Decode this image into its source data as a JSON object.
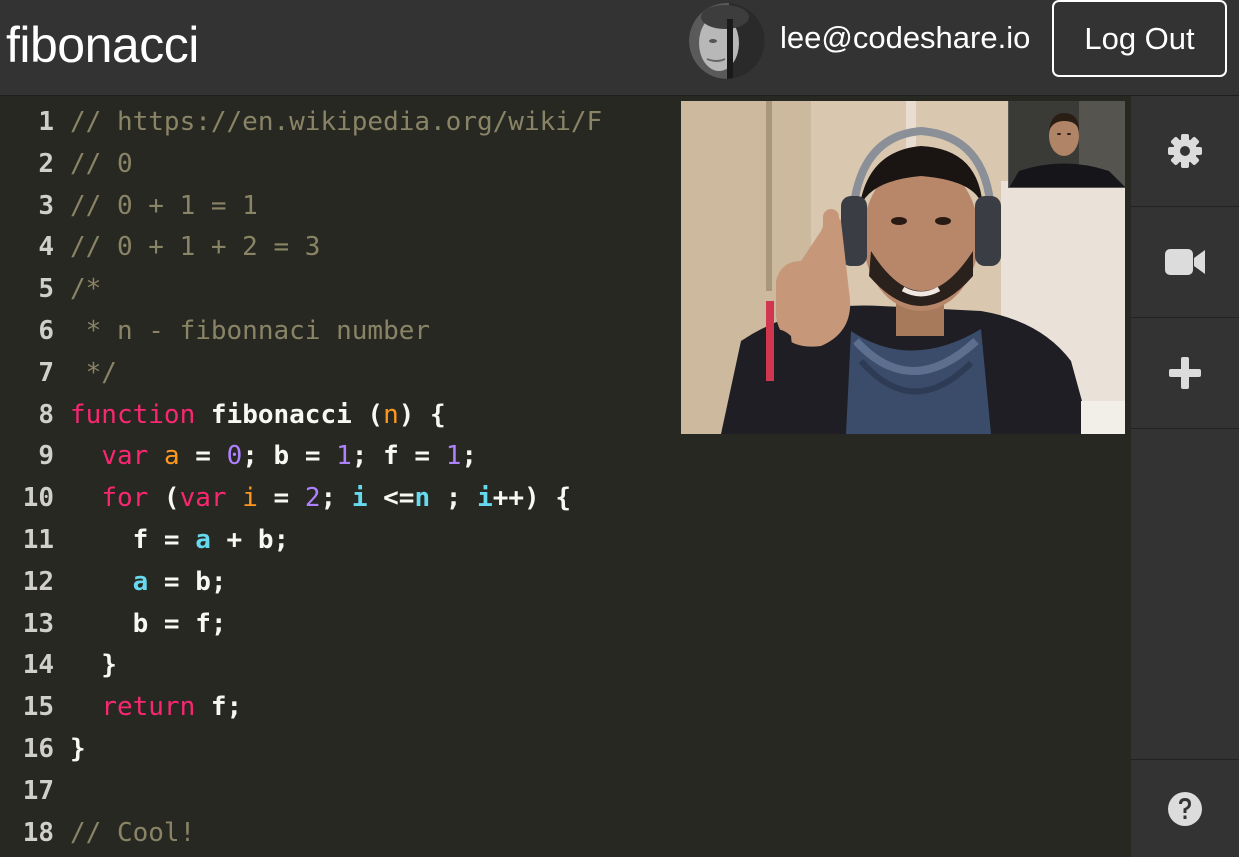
{
  "header": {
    "title": "fibonacci",
    "user_email": "lee@codeshare.io",
    "logout_label": "Log Out",
    "avatar_icon": "user-avatar-photo"
  },
  "editor": {
    "lines": [
      {
        "num": "1",
        "tokens": [
          {
            "t": "// https://en.wikipedia.org/wiki/F",
            "c": "t-comment"
          }
        ]
      },
      {
        "num": "2",
        "tokens": [
          {
            "t": "// 0",
            "c": "t-comment"
          }
        ]
      },
      {
        "num": "3",
        "tokens": [
          {
            "t": "// 0 + 1 = 1",
            "c": "t-comment"
          }
        ]
      },
      {
        "num": "4",
        "tokens": [
          {
            "t": "// 0 + 1 + 2 = 3",
            "c": "t-comment"
          }
        ]
      },
      {
        "num": "5",
        "tokens": [
          {
            "t": "/*",
            "c": "t-comment"
          }
        ]
      },
      {
        "num": "6",
        "tokens": [
          {
            "t": " * n - fibonnaci number",
            "c": "t-comment"
          }
        ]
      },
      {
        "num": "7",
        "tokens": [
          {
            "t": " */",
            "c": "t-comment"
          }
        ]
      },
      {
        "num": "8",
        "tokens": [
          {
            "t": "function",
            "c": "t-kw"
          },
          {
            "t": " fibonacci (",
            "c": "t-plain"
          },
          {
            "t": "n",
            "c": "t-var"
          },
          {
            "t": ") {",
            "c": "t-plain"
          }
        ]
      },
      {
        "num": "9",
        "tokens": [
          {
            "t": "  ",
            "c": "t-plain"
          },
          {
            "t": "var",
            "c": "t-kw"
          },
          {
            "t": " ",
            "c": "t-plain"
          },
          {
            "t": "a",
            "c": "t-var"
          },
          {
            "t": " = ",
            "c": "t-plain"
          },
          {
            "t": "0",
            "c": "t-num"
          },
          {
            "t": "; b = ",
            "c": "t-plain"
          },
          {
            "t": "1",
            "c": "t-num"
          },
          {
            "t": "; f = ",
            "c": "t-plain"
          },
          {
            "t": "1",
            "c": "t-num"
          },
          {
            "t": ";",
            "c": "t-plain"
          }
        ]
      },
      {
        "num": "10",
        "tokens": [
          {
            "t": "  ",
            "c": "t-plain"
          },
          {
            "t": "for",
            "c": "t-kw"
          },
          {
            "t": " (",
            "c": "t-plain"
          },
          {
            "t": "var",
            "c": "t-kw"
          },
          {
            "t": " ",
            "c": "t-plain"
          },
          {
            "t": "i",
            "c": "t-var"
          },
          {
            "t": " = ",
            "c": "t-plain"
          },
          {
            "t": "2",
            "c": "t-num"
          },
          {
            "t": "; ",
            "c": "t-plain"
          },
          {
            "t": "i",
            "c": "t-cyan"
          },
          {
            "t": " <=",
            "c": "t-plain"
          },
          {
            "t": "n",
            "c": "t-cyan"
          },
          {
            "t": " ; ",
            "c": "t-plain"
          },
          {
            "t": "i",
            "c": "t-cyan"
          },
          {
            "t": "++) {",
            "c": "t-plain"
          }
        ]
      },
      {
        "num": "11",
        "tokens": [
          {
            "t": "    f = ",
            "c": "t-plain"
          },
          {
            "t": "a",
            "c": "t-cyan"
          },
          {
            "t": " + b;",
            "c": "t-plain"
          }
        ]
      },
      {
        "num": "12",
        "tokens": [
          {
            "t": "    ",
            "c": "t-plain"
          },
          {
            "t": "a",
            "c": "t-cyan"
          },
          {
            "t": " = b;",
            "c": "t-plain"
          }
        ]
      },
      {
        "num": "13",
        "tokens": [
          {
            "t": "    b = f;",
            "c": "t-plain"
          }
        ]
      },
      {
        "num": "14",
        "tokens": [
          {
            "t": "  }",
            "c": "t-plain"
          }
        ]
      },
      {
        "num": "15",
        "tokens": [
          {
            "t": "  ",
            "c": "t-plain"
          },
          {
            "t": "return",
            "c": "t-kw"
          },
          {
            "t": " f;",
            "c": "t-plain"
          }
        ]
      },
      {
        "num": "16",
        "tokens": [
          {
            "t": "}",
            "c": "t-plain"
          }
        ]
      },
      {
        "num": "17",
        "tokens": []
      },
      {
        "num": "18",
        "tokens": [
          {
            "t": "// Cool!",
            "c": "t-comment"
          }
        ]
      }
    ]
  },
  "sidebar": {
    "items": [
      {
        "icon": "gear-icon"
      },
      {
        "icon": "video-camera-icon"
      },
      {
        "icon": "plus-icon"
      }
    ],
    "help_icon": "help-icon"
  },
  "colors": {
    "editor_bg": "#272822",
    "chrome_bg": "#333333",
    "keyword": "#f92672",
    "variable": "#fd971f",
    "number": "#ae81ff",
    "identifier": "#66d9ef",
    "comment": "#8a8466"
  }
}
